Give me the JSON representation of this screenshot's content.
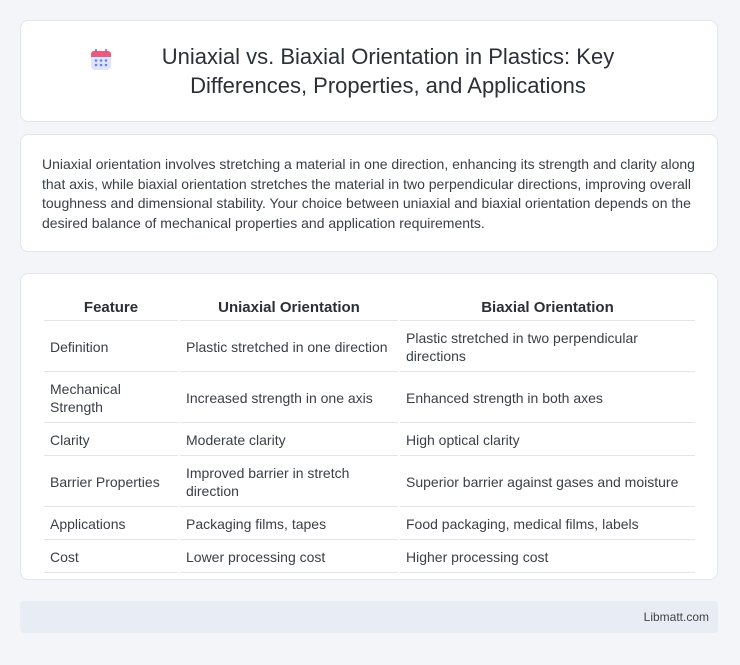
{
  "header": {
    "title": "Uniaxial vs. Biaxial Orientation in Plastics: Key Differences, Properties, and Applications",
    "icon": "calendar-icon"
  },
  "summary": {
    "text": "Uniaxial orientation involves stretching a material in one direction, enhancing its strength and clarity along that axis, while biaxial orientation stretches the material in two perpendicular directions, improving overall toughness and dimensional stability. Your choice between uniaxial and biaxial orientation depends on the desired balance of mechanical properties and application requirements."
  },
  "table": {
    "headers": [
      "Feature",
      "Uniaxial Orientation",
      "Biaxial Orientation"
    ],
    "rows": [
      [
        "Definition",
        "Plastic stretched in one direction",
        "Plastic stretched in two perpendicular directions"
      ],
      [
        "Mechanical Strength",
        "Increased strength in one axis",
        "Enhanced strength in both axes"
      ],
      [
        "Clarity",
        "Moderate clarity",
        "High optical clarity"
      ],
      [
        "Barrier Properties",
        "Improved barrier in stretch direction",
        "Superior barrier against gases and moisture"
      ],
      [
        "Applications",
        "Packaging films, tapes",
        "Food packaging, medical films, labels"
      ],
      [
        "Cost",
        "Lower processing cost",
        "Higher processing cost"
      ]
    ]
  },
  "footer": {
    "text": "Libmatt.com"
  }
}
